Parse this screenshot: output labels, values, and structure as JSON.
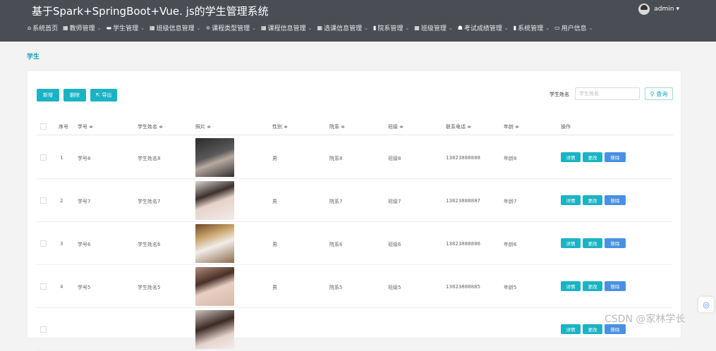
{
  "header": {
    "title": "基于Spark+SpringBoot+Vue. js的学生管理系统",
    "user": "admin",
    "user_caret": "▾"
  },
  "menu": [
    {
      "icon": "⌂",
      "label": "系统首页",
      "caret": ""
    },
    {
      "icon": "▦",
      "label": "教师管理",
      "caret": "⌄"
    },
    {
      "icon": "▬",
      "label": "学生管理",
      "caret": "⌄"
    },
    {
      "icon": "▦",
      "label": "班级信息管理",
      "caret": "⌄"
    },
    {
      "icon": "≑",
      "label": "课程类型管理",
      "caret": "⌄"
    },
    {
      "icon": "▦",
      "label": "课程信息管理",
      "caret": "⌄"
    },
    {
      "icon": "▦",
      "label": "选课信息管理",
      "caret": "⌄"
    },
    {
      "icon": "▮",
      "label": "院系管理",
      "caret": "⌄"
    },
    {
      "icon": "▦",
      "label": "班级管理",
      "caret": "⌄"
    },
    {
      "icon": "☗",
      "label": "考试成绩管理",
      "caret": "⌄"
    },
    {
      "icon": "▮",
      "label": "系统管理",
      "caret": "⌄"
    },
    {
      "icon": "▭",
      "label": "用户信息",
      "caret": "⌄"
    }
  ],
  "breadcrumb": "学生",
  "toolbar": {
    "add_label": "新增",
    "delete_label": "删除",
    "export_icon": "⇱",
    "export_label": "导出"
  },
  "search": {
    "label": "学生姓名",
    "placeholder": "学生姓名",
    "button_icon": "⚲",
    "button_label": "查询"
  },
  "table": {
    "columns": {
      "index": "序号",
      "student_no": "学号 ≑",
      "name": "学生姓名 ≑",
      "photo": "照片 ≑",
      "gender": "性别 ≑",
      "department": "院系 ≑",
      "class": "班级 ≑",
      "phone": "联系电话 ≑",
      "age": "年龄 ≑",
      "actions": "操作"
    },
    "rows": [
      {
        "index": "1",
        "student_no": "学号8",
        "name": "学生姓名8",
        "gender": "男",
        "department": "院系8",
        "class": "班级8",
        "phone": "13823888888",
        "age": "年龄8",
        "detail": "详情",
        "edit": "更改",
        "remove": "移除"
      },
      {
        "index": "2",
        "student_no": "学号7",
        "name": "学生姓名7",
        "gender": "男",
        "department": "院系7",
        "class": "班级7",
        "phone": "13823888887",
        "age": "年龄7",
        "detail": "详情",
        "edit": "更改",
        "remove": "移除"
      },
      {
        "index": "3",
        "student_no": "学号6",
        "name": "学生姓名6",
        "gender": "男",
        "department": "院系6",
        "class": "班级6",
        "phone": "13823888886",
        "age": "年龄6",
        "detail": "详情",
        "edit": "更改",
        "remove": "移除"
      },
      {
        "index": "4",
        "student_no": "学号5",
        "name": "学生姓名5",
        "gender": "男",
        "department": "院系5",
        "class": "班级5",
        "phone": "13823888885",
        "age": "年龄5",
        "detail": "详情",
        "edit": "更改",
        "remove": "移除"
      },
      {
        "index": "",
        "student_no": "",
        "name": "",
        "gender": "",
        "department": "",
        "class": "",
        "phone": "",
        "age": "",
        "detail": "详情",
        "edit": "更改",
        "remove": "移除"
      }
    ]
  },
  "watermark": "CSDN @家林学长",
  "colors": {
    "header_bg": "#4a4e54",
    "accent_teal": "#1ab3c4",
    "accent_blue": "#4a90e2"
  }
}
